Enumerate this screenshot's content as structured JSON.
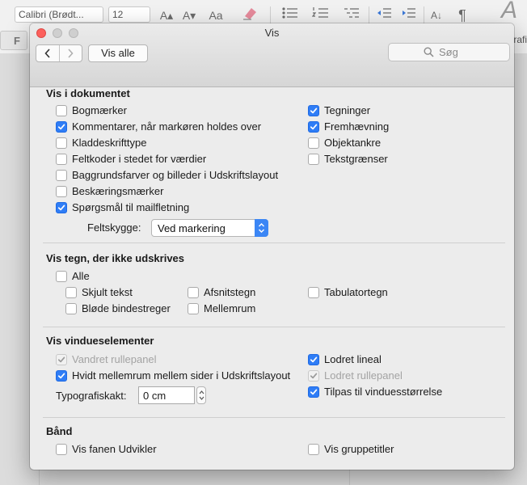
{
  "background_app": {
    "font_name": "Calibri (Brødt...",
    "font_size": "12",
    "right_snippet": "rafi",
    "side_button": "F"
  },
  "window": {
    "title": "Vis",
    "show_all": "Vis alle",
    "search_placeholder": "Søg"
  },
  "sections": {
    "document": {
      "title": "Vis i dokumentet",
      "left": [
        {
          "label": "Bogmærker",
          "checked": false,
          "disabled": false
        },
        {
          "label": "Kommentarer, når markøren holdes over",
          "checked": true,
          "disabled": false
        },
        {
          "label": "Kladdeskrifttype",
          "checked": false,
          "disabled": false
        },
        {
          "label": "Feltkoder i stedet for værdier",
          "checked": false,
          "disabled": false
        },
        {
          "label": "Baggrundsfarver og billeder i Udskriftslayout",
          "checked": false,
          "disabled": false
        },
        {
          "label": "Beskæringsmærker",
          "checked": false,
          "disabled": false
        },
        {
          "label": "Spørgsmål til mailfletning",
          "checked": true,
          "disabled": false
        }
      ],
      "right": [
        {
          "label": "Tegninger",
          "checked": true,
          "disabled": false
        },
        {
          "label": "Fremhævning",
          "checked": true,
          "disabled": false
        },
        {
          "label": "Objektankre",
          "checked": false,
          "disabled": false
        },
        {
          "label": "Tekstgrænser",
          "checked": false,
          "disabled": false
        }
      ],
      "field_shading_label": "Feltskygge:",
      "field_shading_value": "Ved markering"
    },
    "nonprinting": {
      "title": "Vis tegn, der ikke udskrives",
      "all": {
        "label": "Alle",
        "checked": false
      },
      "options": [
        {
          "label": "Skjult tekst",
          "checked": false
        },
        {
          "label": "Afsnitstegn",
          "checked": false
        },
        {
          "label": "Tabulatortegn",
          "checked": false
        },
        {
          "label": "Bløde bindestreger",
          "checked": false
        },
        {
          "label": "Mellemrum",
          "checked": false
        }
      ]
    },
    "window_elements": {
      "title": "Vis vindueselementer",
      "left": [
        {
          "label": "Vandret rullepanel",
          "checked": true,
          "disabled": true
        },
        {
          "label": "Hvidt mellemrum mellem sider i Udskriftslayout",
          "checked": true,
          "disabled": false
        }
      ],
      "right": [
        {
          "label": "Lodret lineal",
          "checked": true,
          "disabled": false
        },
        {
          "label": "Lodret rullepanel",
          "checked": true,
          "disabled": true
        },
        {
          "label": "Tilpas til vinduesstørrelse",
          "checked": true,
          "disabled": false
        }
      ],
      "typo_label": "Typografiskakt:",
      "typo_value": "0 cm"
    },
    "ribbon": {
      "title": "Bånd",
      "options": [
        {
          "label": "Vis fanen Udvikler",
          "checked": false
        },
        {
          "label": "Vis gruppetitler",
          "checked": false
        }
      ]
    }
  },
  "colors": {
    "accent": "#2f7df6",
    "close": "#fc605c"
  }
}
